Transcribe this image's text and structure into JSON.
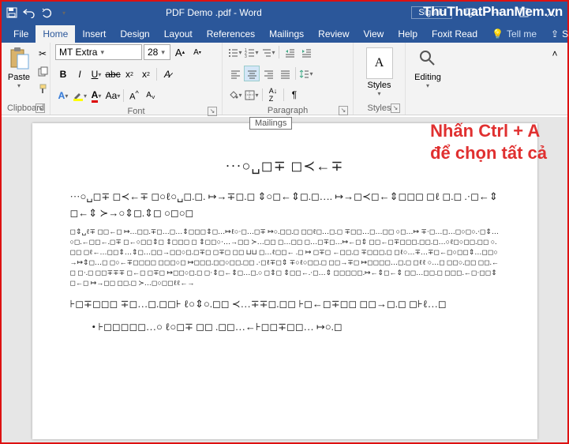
{
  "titlebar": {
    "title": "PDF Demo .pdf - Word",
    "signin": "Sign in"
  },
  "watermark": "ThuThuatPhanMem.vn",
  "tabs": {
    "file": "File",
    "home": "Home",
    "insert": "Insert",
    "design": "Design",
    "layout": "Layout",
    "references": "References",
    "mailings": "Mailings",
    "review": "Review",
    "view": "View",
    "help": "Help",
    "foxit": "Foxit Read",
    "tellme": "Tell me",
    "share": "Share"
  },
  "ribbon": {
    "clipboard": {
      "label": "Clipboard",
      "paste": "Paste"
    },
    "font": {
      "label": "Font",
      "name": "MT Extra",
      "size": "28"
    },
    "paragraph": {
      "label": "Paragraph"
    },
    "styles": {
      "label": "Styles",
      "btn": "Styles",
      "sample": "¶"
    },
    "editing": {
      "label": "",
      "btn": "Editing"
    }
  },
  "tooltip": "Mailings",
  "annotation": {
    "line1": "Nhấn Ctrl + A",
    "line2": "để chọn tất cả"
  },
  "document": {
    "heading": "···○␣◻∓ ◻≺←∓",
    "para1": "···○␣◻∓ ◻≺←∓ ◻○ℓ○␣◻.◻. ↦→∓◻.◻ ⇕○◻←⇕◻.◻…. ↦→◻≺◻←⇕◻◻◻ ◻ℓ ◻.◻ .·◻←⇕ ◻←⇕ ≻→○⇕◻.⇕◻  ○◻○◻",
    "para2": "◻⇕␣ℓ∓ ◻◻←◻ ↦…◻◻.∓◻…◻…⇕◻◻◻⇕◻…↦ℓ○·◻…◻∓ ↦○.◻◻.◻ ◻◻ℓ◻…◻.◻ ∓◻◻…◻…◻◻ ○◻…↦ ∓·◻…◻…◻○◻○.·◻⇕…○◻.←◻◻←.◻∓ ◻←○◻◻⇕◻ ⇕◻◻◻ ◻ ⇕◻◻○·…→◻◻ ≻…◻◻ ◻…◻◻ ◻…◻∓◻…↦←◻⇕ ◻◻←◻∓◻◻◻.◻◻.◻…○ℓ◻○◻◻.◻◻ ○.◻◻ ◻ℓ←…◻◻⇕…⇕◻…◻◻→◻◻○◻.◻∓◻ ◻∓◻ ◻◻ ⊔⊔ ◻…ℓ◻◻← .◻ ↦ ◻∓◻ ←◻◻.◻ ∓◻◻◻.◻ ◻ℓ○…∓…∓◻←◻○◻◻⇕…◻◻○→↦⇕◻…◻ ◻○←∓◻◻◻◻ ◻◻◻○◻ ↦◻◻◻.◻◻○◻◻.◻◻ .·◻ℓ∓◻⇕ ∓○ℓ○◻◻.◻ ◻◻→∓◻ ↦◻◻◻◻…◻.◻ ◻ℓℓ ○…◻ ◻◻○.◻◻ ◻◻.←◻ ◻·.◻ ◻◻∓∓∓ ◻←◻ ◻∓◻ ↦◻◻○◻.◻ ◻·⇕◻←⇕◻…◻.○ ◻⇕◻ ⇕◻◻←.·◻…⇕ ◻◻◻◻◻.↦←⇕◻←⇕ ◻◻…◻◻.◻ ◻◻◻.←◻·◻◻⇕◻←◻ ↦→◻◻ ◻◻.◻ ≻…◻○◻◻ℓℓ←→",
    "para3": "⊦◻∓◻◻◻ ∓◻…◻.◻◻⊦ ℓ○⇕○.◻◻ ≺…∓∓◻.◻◻ ⊦◻←◻∓◻◻ ◻◻→◻.◻ ◻⊦ℓ…◻",
    "bullet": "⊦◻◻◻◻◻…○ ℓ○◻∓ ◻◻ .◻◻…←⊦◻◻∓◻◻… ↦○.◻"
  }
}
